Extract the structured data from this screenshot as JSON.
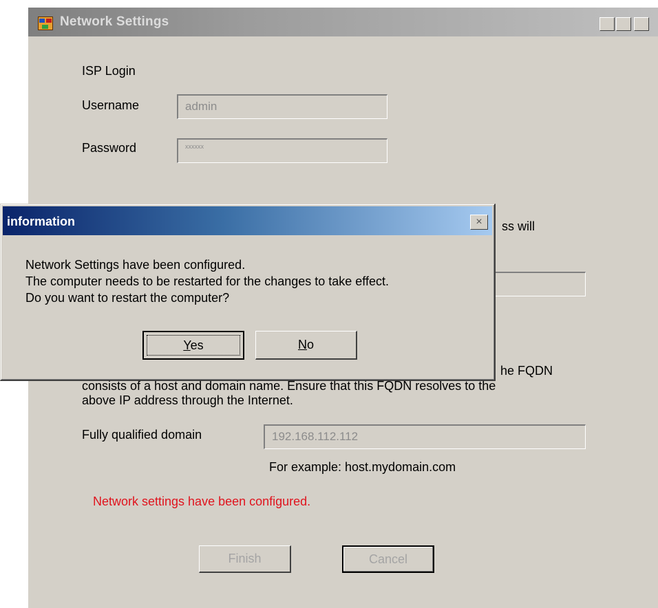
{
  "window": {
    "title": "Network Settings",
    "minimize": "_",
    "maximize": "□",
    "close": "×"
  },
  "isp": {
    "heading": "ISP Login",
    "username_label": "Username",
    "username_value": "admin",
    "password_label": "Password",
    "password_value": "xxxxxx"
  },
  "partial": {
    "right_text": "ss will"
  },
  "fqdn": {
    "para_line1_tail": "he FQDN",
    "para_line2": "consists of a host and domain name. Ensure that this FQDN resolves to the",
    "para_line3": "above IP address through the Internet.",
    "label": "Fully qualified domain",
    "value": "192.168.112.112",
    "example": "For example:  host.mydomain.com"
  },
  "status_message": "Network settings have been configured.",
  "buttons": {
    "finish": "Finish",
    "cancel": "Cancel"
  },
  "dialog": {
    "title": "information",
    "close": "×",
    "message_lines": [
      "Network Settings have been configured.",
      "The computer needs to be restarted for the changes to take effect.",
      "Do you want to restart the computer?"
    ],
    "yes_underline": "Y",
    "yes_rest": "es",
    "no_underline": "N",
    "no_rest": "o"
  },
  "colors": {
    "status_text": "#e0141e",
    "dialog_title_start": "#0a246a",
    "dialog_title_end": "#a6caf0",
    "window_face": "#d4d0c8"
  }
}
